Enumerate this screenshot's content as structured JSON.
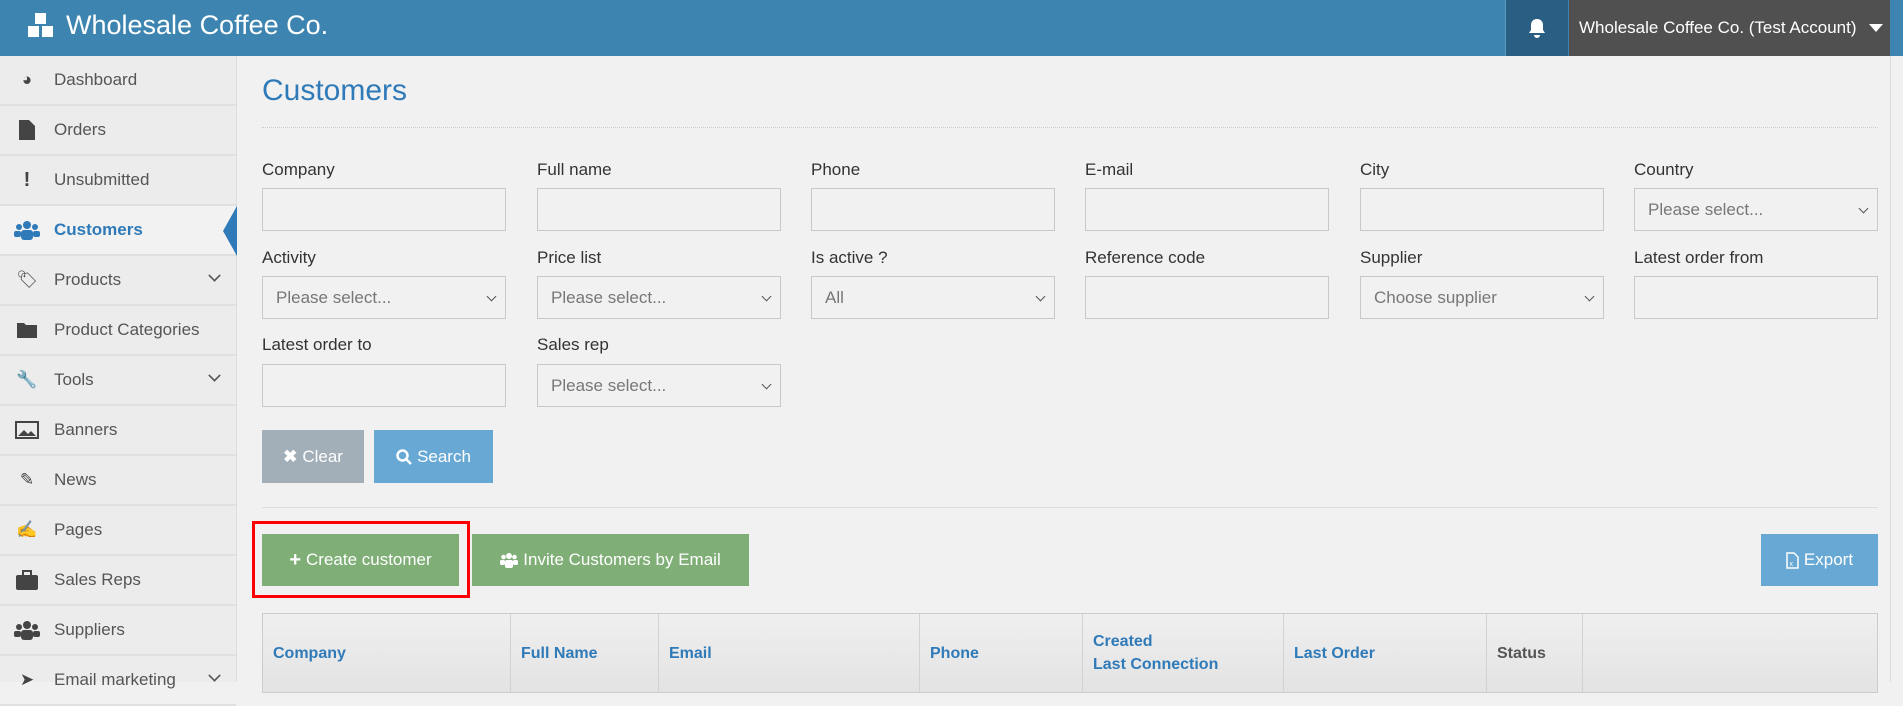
{
  "header": {
    "brand": "Wholesale Coffee Co.",
    "account": "Wholesale Coffee Co. (Test Account)"
  },
  "sidebar": {
    "items": [
      {
        "label": "Dashboard",
        "icon": "dashboard-icon"
      },
      {
        "label": "Orders",
        "icon": "file-icon"
      },
      {
        "label": "Unsubmitted",
        "icon": "exclamation-icon"
      },
      {
        "label": "Customers",
        "icon": "users-icon",
        "active": true
      },
      {
        "label": "Products",
        "icon": "tag-icon",
        "expandable": true
      },
      {
        "label": "Product Categories",
        "icon": "folder-icon"
      },
      {
        "label": "Tools",
        "icon": "wrench-icon",
        "expandable": true
      },
      {
        "label": "Banners",
        "icon": "image-icon"
      },
      {
        "label": "News",
        "icon": "pencil-icon"
      },
      {
        "label": "Pages",
        "icon": "edit-icon"
      },
      {
        "label": "Sales Reps",
        "icon": "briefcase-icon"
      },
      {
        "label": "Suppliers",
        "icon": "users-icon"
      },
      {
        "label": "Email marketing",
        "icon": "paper-plane-icon",
        "expandable": true
      }
    ]
  },
  "page": {
    "title": "Customers"
  },
  "filters": {
    "company": {
      "label": "Company",
      "value": ""
    },
    "full_name": {
      "label": "Full name",
      "value": ""
    },
    "phone": {
      "label": "Phone",
      "value": ""
    },
    "email": {
      "label": "E-mail",
      "value": ""
    },
    "city": {
      "label": "City",
      "value": ""
    },
    "country": {
      "label": "Country",
      "value": "Please select..."
    },
    "activity": {
      "label": "Activity",
      "value": "Please select..."
    },
    "price_list": {
      "label": "Price list",
      "value": "Please select..."
    },
    "is_active": {
      "label": "Is active ?",
      "value": "All"
    },
    "reference_code": {
      "label": "Reference code",
      "value": ""
    },
    "supplier": {
      "label": "Supplier",
      "value": "Choose supplier"
    },
    "latest_order_from": {
      "label": "Latest order from",
      "value": ""
    },
    "latest_order_to": {
      "label": "Latest order to",
      "value": ""
    },
    "sales_rep": {
      "label": "Sales rep",
      "value": "Please select..."
    }
  },
  "actions": {
    "clear": "Clear",
    "search": "Search",
    "create": "Create customer",
    "invite": "Invite Customers by Email",
    "export": "Export"
  },
  "table": {
    "columns": [
      "Company",
      "Full Name",
      "Email",
      "Phone",
      "Created",
      "Last Connection",
      "Last Order",
      "Status"
    ]
  },
  "colors": {
    "brand": "#3d85b0",
    "accent": "#2f7ab8",
    "green": "#7fae76",
    "blue_btn": "#67a8d4",
    "grey_btn": "#a2afb8"
  }
}
